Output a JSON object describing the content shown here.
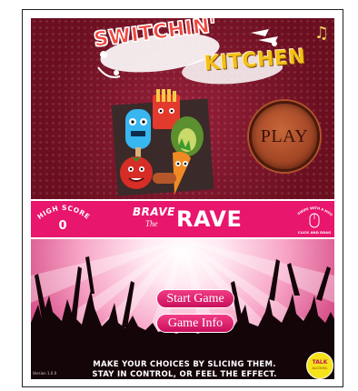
{
  "game": {
    "title_line1": "SWITCHIN'",
    "title_line2": "KITCHEN",
    "music_icon": "music-note-icon",
    "play_label": "PLAY",
    "high_score_label": "HIGH SCORE",
    "high_score_value": "0",
    "brave_word": "BRAVE",
    "the_word": "The",
    "rave_word": "RAVE",
    "mouse_hint_top": "TO SWIPE WITH A MOUSE",
    "mouse_hint_bottom": "CLICK AND DRAG",
    "menu": {
      "start_label": "Start Game",
      "info_label": "Game Info"
    },
    "instructions": [
      "MAKE YOUR CHOICES BY SLICING THEM.",
      "STAY IN CONTROL, OR FEEL THE EFFECT."
    ],
    "version": "Version 1.0.0",
    "badge_top": "TALK",
    "badge_bottom": "ALCOHOL",
    "colors": {
      "maroon": "#7d1324",
      "pink": "#e8166c",
      "logo_red": "#f0483e",
      "logo_yellow": "#f3c01a",
      "play_orange": "#a24625"
    }
  }
}
